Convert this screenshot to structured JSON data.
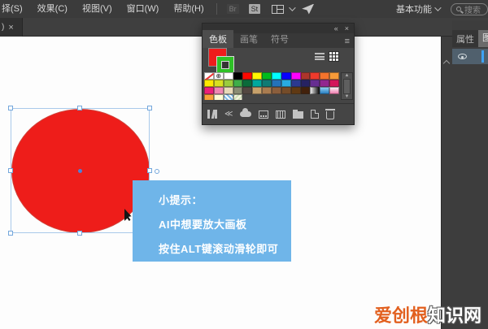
{
  "menubar": {
    "items": [
      "择(S)",
      "效果(C)",
      "视图(V)",
      "窗口(W)",
      "帮助(H)"
    ],
    "bridge_label": "Br",
    "stock_label": "St",
    "workspace_label": "基本功能",
    "search_placeholder": "搜索"
  },
  "tabbar": {
    "doc_tab_label": ")",
    "close_label": "×"
  },
  "swatches_panel": {
    "header": {
      "collapse_icon": "«",
      "close_icon": "×"
    },
    "tabs": [
      {
        "label": "色板",
        "active": true
      },
      {
        "label": "画笔",
        "active": false
      },
      {
        "label": "符号",
        "active": false
      }
    ],
    "panel_menu_icon": "≡",
    "fill_color": "#ee1c1c",
    "stroke_color": "#2fc127",
    "scroll_up_icon": "▲",
    "scroll_down_icon": "▼",
    "grid_rows": [
      [
        "none",
        "registration",
        "#ffffff",
        "#000000",
        "#fe0800",
        "#fff600",
        "#00bb1d",
        "#00ffff",
        "#0800ff",
        "#ff00ff",
        "#ad352b",
        "#ee3a2c",
        "#f4732c",
        "#f89a38"
      ],
      [
        "#ffe800",
        "#d9e021",
        "#9bcc3d",
        "#3fae49",
        "#0b6b3a",
        "#00a99d",
        "#0f7b74",
        "#2472b9",
        "#29abe2",
        "#2b3990",
        "#262262",
        "#662d91",
        "#92278f",
        "#d4145a"
      ],
      [
        "#ed1e79",
        "#ef87b2",
        "#e8d9b8",
        "#8a8d74",
        "#534741",
        "#c7a16b",
        "#a97c50",
        "#8b5e3c",
        "#754c29",
        "#603913",
        "#42210b",
        "grad-bw",
        "grad-blue",
        "grad-pink"
      ],
      [
        "#f9a13a",
        "#fdfbd4",
        "pattern-blue",
        "pattern-tan",
        "empty",
        "empty",
        "empty",
        "empty",
        "empty",
        "empty",
        "empty",
        "empty",
        "empty",
        "empty"
      ]
    ],
    "footer_icons": [
      "swatch-libraries-icon",
      "swatch-kinds-icon",
      "add-to-library-icon",
      "swatch-options-icon",
      "color-themes-icon",
      "new-color-group-icon",
      "new-swatch-icon",
      "delete-swatch-icon"
    ]
  },
  "canvas": {
    "shape_fill": "#ee1d1a",
    "selection_color": "#74a7dc",
    "tooltip": {
      "bg": "#6fb5e9",
      "lines": [
        "小提示：",
        "AI中想要放大画板",
        "按住ALT键滚动滑轮即可"
      ]
    }
  },
  "right_panel": {
    "tabs": [
      "属性",
      "图层"
    ],
    "layer_accent_color": "#3fa3f5"
  },
  "watermark": {
    "part1": "爱创根",
    "part2": "知识网",
    "part1_color": "#e2601f"
  }
}
